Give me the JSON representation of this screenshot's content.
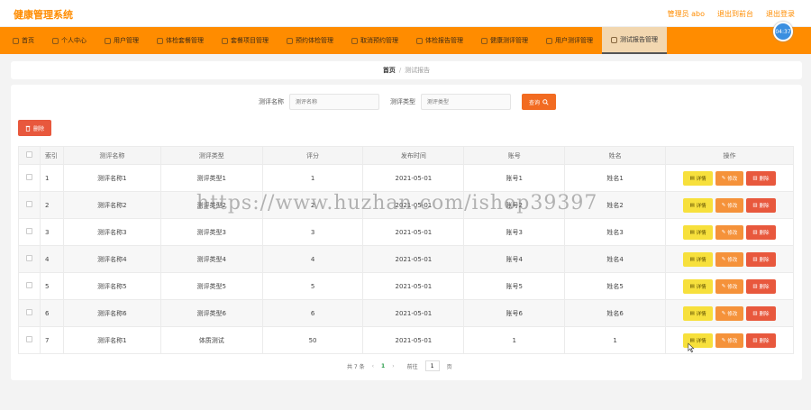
{
  "header": {
    "app_title": "健康管理系统",
    "user_label": "管理员 abo",
    "back_label": "退出到前台",
    "logout_label": "退出登录"
  },
  "timer": "04:37",
  "nav": {
    "items": [
      {
        "label": "首页"
      },
      {
        "label": "个人中心"
      },
      {
        "label": "用户管理"
      },
      {
        "label": "体检套餐管理"
      },
      {
        "label": "套餐项目管理"
      },
      {
        "label": "预约体检管理"
      },
      {
        "label": "取消预约管理"
      },
      {
        "label": "体检报告管理"
      },
      {
        "label": "健康测评管理"
      },
      {
        "label": "用户测评管理"
      },
      {
        "label": "测试报告管理"
      }
    ],
    "active_index": 10
  },
  "breadcrumb": {
    "home": "首页",
    "separator": "/",
    "current": "测试报告"
  },
  "search": {
    "name_label": "测评名称",
    "name_placeholder": "测评名称",
    "type_label": "测评类型",
    "type_placeholder": "测评类型",
    "query_label": "查询"
  },
  "toolbar": {
    "delete_label": "删除"
  },
  "table": {
    "headers": [
      "索引",
      "测评名称",
      "测评类型",
      "评分",
      "发布时间",
      "账号",
      "姓名",
      "操作"
    ],
    "rows": [
      {
        "index": "1",
        "name": "测评名称1",
        "type": "测评类型1",
        "score": "1",
        "date": "2021-05-01",
        "account": "账号1",
        "person": "姓名1"
      },
      {
        "index": "2",
        "name": "测评名称2",
        "type": "测评类型2",
        "score": "2",
        "date": "2021-05-01",
        "account": "账号2",
        "person": "姓名2"
      },
      {
        "index": "3",
        "name": "测评名称3",
        "type": "测评类型3",
        "score": "3",
        "date": "2021-05-01",
        "account": "账号3",
        "person": "姓名3"
      },
      {
        "index": "4",
        "name": "测评名称4",
        "type": "测评类型4",
        "score": "4",
        "date": "2021-05-01",
        "account": "账号4",
        "person": "姓名4"
      },
      {
        "index": "5",
        "name": "测评名称5",
        "type": "测评类型5",
        "score": "5",
        "date": "2021-05-01",
        "account": "账号5",
        "person": "姓名5"
      },
      {
        "index": "6",
        "name": "测评名称6",
        "type": "测评类型6",
        "score": "6",
        "date": "2021-05-01",
        "account": "账号6",
        "person": "姓名6"
      },
      {
        "index": "7",
        "name": "测评名称1",
        "type": "体质测试",
        "score": "50",
        "date": "2021-05-01",
        "account": "1",
        "person": "1"
      }
    ],
    "actions": {
      "view": "详情",
      "edit": "修改",
      "delete": "删除"
    }
  },
  "pagination": {
    "total_text": "共 7 条",
    "prev": "‹",
    "current_page": "1",
    "next": "›",
    "goto_label": "前往",
    "goto_value": "1",
    "page_suffix": "页"
  },
  "watermark": "https://www.huzhan.com/ishop39397",
  "colors": {
    "brand": "#ff8c00",
    "query": "#f26b21",
    "delete": "#e8583d",
    "edit": "#f5923a",
    "view": "#f7e03c"
  }
}
